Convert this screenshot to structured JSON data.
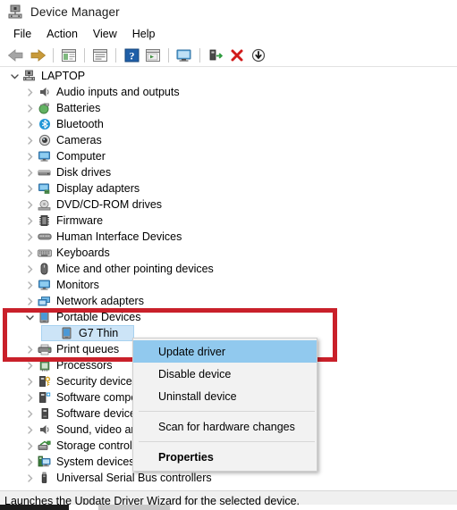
{
  "window": {
    "title": "Device Manager",
    "title_icon": "device-manager-icon"
  },
  "menubar": {
    "items": [
      {
        "label": "File",
        "name": "menu-file"
      },
      {
        "label": "Action",
        "name": "menu-action"
      },
      {
        "label": "View",
        "name": "menu-view"
      },
      {
        "label": "Help",
        "name": "menu-help"
      }
    ]
  },
  "toolbar": {
    "buttons": [
      {
        "name": "back-arrow-icon",
        "tip": "Back"
      },
      {
        "name": "forward-arrow-icon",
        "tip": "Forward"
      },
      {
        "name": "show-hide-console-tree-icon",
        "tip": "Show/Hide console tree"
      },
      {
        "name": "properties-icon",
        "tip": "Properties"
      },
      {
        "name": "help-icon",
        "tip": "Help"
      },
      {
        "name": "update-driver-icon",
        "tip": "Update driver"
      },
      {
        "name": "scan-hardware-changes-icon",
        "tip": "Scan for hardware changes"
      },
      {
        "name": "enable-device-icon",
        "tip": "Enable device"
      },
      {
        "name": "uninstall-device-icon",
        "tip": "Uninstall device"
      },
      {
        "name": "disable-device-icon",
        "tip": "Disable device"
      }
    ]
  },
  "tree": {
    "root": {
      "label": "LAPTOP",
      "icon": "computer-root-icon",
      "expanded": true
    },
    "nodes": [
      {
        "label": "Audio inputs and outputs",
        "icon": "speaker-icon",
        "expanded": false
      },
      {
        "label": "Batteries",
        "icon": "battery-icon",
        "expanded": false
      },
      {
        "label": "Bluetooth",
        "icon": "bluetooth-icon",
        "expanded": false
      },
      {
        "label": "Cameras",
        "icon": "camera-icon",
        "expanded": false
      },
      {
        "label": "Computer",
        "icon": "monitor-icon",
        "expanded": false
      },
      {
        "label": "Disk drives",
        "icon": "disk-drive-icon",
        "expanded": false
      },
      {
        "label": "Display adapters",
        "icon": "display-adapter-icon",
        "expanded": false
      },
      {
        "label": "DVD/CD-ROM drives",
        "icon": "optical-drive-icon",
        "expanded": false
      },
      {
        "label": "Firmware",
        "icon": "firmware-chip-icon",
        "expanded": false
      },
      {
        "label": "Human Interface Devices",
        "icon": "hid-icon",
        "expanded": false
      },
      {
        "label": "Keyboards",
        "icon": "keyboard-icon",
        "expanded": false
      },
      {
        "label": "Mice and other pointing devices",
        "icon": "mouse-icon",
        "expanded": false
      },
      {
        "label": "Monitors",
        "icon": "monitor-icon",
        "expanded": false
      },
      {
        "label": "Network adapters",
        "icon": "network-adapter-icon",
        "expanded": false
      },
      {
        "label": "Portable Devices",
        "icon": "portable-device-icon",
        "expanded": true
      },
      {
        "label": "Print queues",
        "icon": "printer-icon",
        "expanded": false
      },
      {
        "label": "Processors",
        "icon": "processor-icon",
        "expanded": false
      },
      {
        "label": "Security devices",
        "icon": "security-device-icon",
        "expanded": false
      },
      {
        "label": "Software components",
        "icon": "software-component-icon",
        "expanded": false
      },
      {
        "label": "Software devices",
        "icon": "software-device-icon",
        "expanded": false
      },
      {
        "label": "Sound, video and game controllers",
        "icon": "sound-video-icon",
        "expanded": false
      },
      {
        "label": "Storage controllers",
        "icon": "storage-controller-icon",
        "expanded": false
      },
      {
        "label": "System devices",
        "icon": "system-device-icon",
        "expanded": false
      },
      {
        "label": "Universal Serial Bus controllers",
        "icon": "usb-controller-icon",
        "expanded": false
      }
    ],
    "child": {
      "label": "G7 Thin",
      "icon": "portable-device-icon",
      "selected": true
    }
  },
  "context_menu": {
    "items": [
      {
        "label": "Update driver",
        "highlighted": true,
        "bold": false,
        "separator_after": false
      },
      {
        "label": "Disable device",
        "highlighted": false,
        "bold": false,
        "separator_after": false
      },
      {
        "label": "Uninstall device",
        "highlighted": false,
        "bold": false,
        "separator_after": true
      },
      {
        "label": "Scan for hardware changes",
        "highlighted": false,
        "bold": false,
        "separator_after": true
      },
      {
        "label": "Properties",
        "highlighted": false,
        "bold": true,
        "separator_after": false
      }
    ]
  },
  "annotation": {
    "highlight_color": "#c9202a",
    "name": "red-highlight-box"
  },
  "statusbar": {
    "text": "Launches the Update Driver Wizard for the selected device."
  },
  "colors": {
    "selection": "#cce4f7",
    "menu_highlight": "#91c9ee",
    "accent_red": "#c9202a"
  }
}
